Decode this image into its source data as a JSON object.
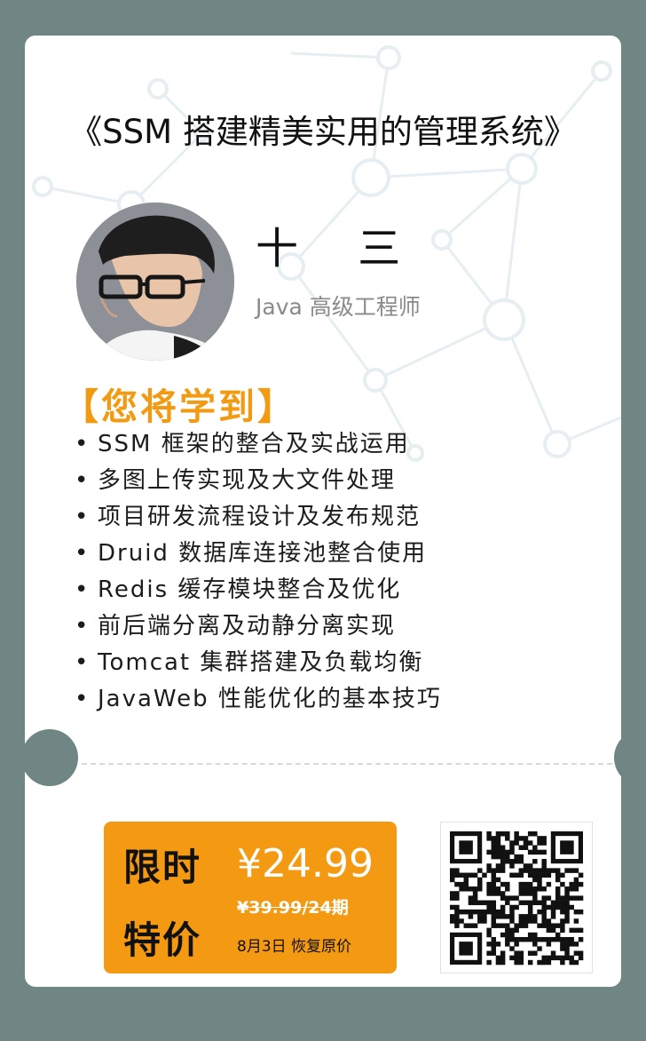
{
  "course": {
    "title": "《SSM 搭建精美实用的管理系统》"
  },
  "instructor": {
    "name": "十 三",
    "role": "Java 高级工程师"
  },
  "learn": {
    "heading": "【您将学到】",
    "points": [
      "SSM 框架的整合及实战运用",
      "多图上传实现及大文件处理",
      "项目研发流程设计及发布规范",
      "Druid 数据库连接池整合使用",
      "Redis 缓存模块整合及优化",
      "前后端分离及动静分离实现",
      "Tomcat 集群搭建及负载均衡",
      "JavaWeb 性能优化的基本技巧"
    ]
  },
  "promo": {
    "limited_label": "限时",
    "special_label": "特价",
    "price": "¥24.99",
    "original_price": "¥39.99/24期",
    "restore_note": "8月3日 恢复原价"
  },
  "colors": {
    "accent": "#f49a12",
    "frame": "#6f8685",
    "card": "#ffffff"
  },
  "icons": {
    "qr": "qr-code-icon",
    "avatar": "instructor-photo"
  }
}
